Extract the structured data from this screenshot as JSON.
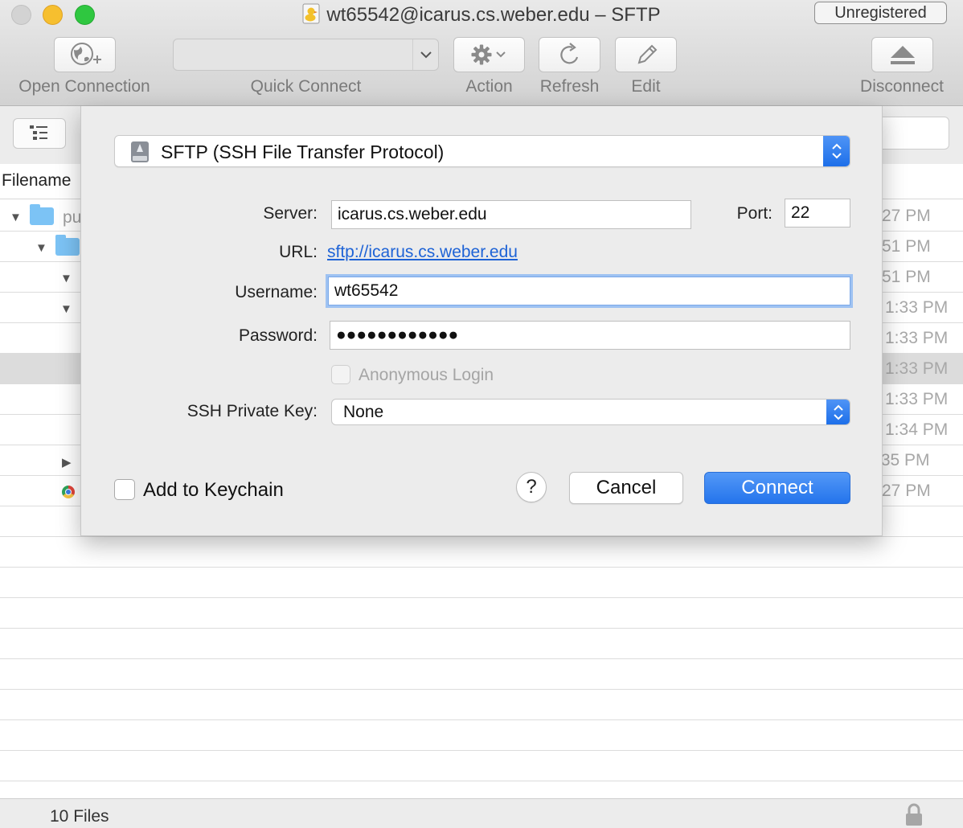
{
  "window": {
    "title": "wt65542@icarus.cs.weber.edu – SFTP",
    "badge": "Unregistered"
  },
  "toolbar": {
    "open_connection": "Open Connection",
    "quick_connect": "Quick Connect",
    "action": "Action",
    "refresh": "Refresh",
    "edit": "Edit",
    "disconnect": "Disconnect"
  },
  "browser": {
    "column_filename": "Filename",
    "rows": [
      {
        "name": "pu",
        "date": "27 PM"
      },
      {
        "name": "",
        "date": "51 PM"
      },
      {
        "name": "",
        "date": "51 PM"
      },
      {
        "name": "",
        "date": "1:33 PM"
      },
      {
        "name": "",
        "date": "1:33 PM"
      },
      {
        "name": "",
        "date": "1:33 PM"
      },
      {
        "name": "",
        "date": "1:33 PM"
      },
      {
        "name": "",
        "date": "1:34 PM"
      },
      {
        "name": "",
        "date": ":35 PM"
      },
      {
        "name": "",
        "date": "27 PM"
      }
    ],
    "status": "10 Files"
  },
  "sheet": {
    "protocol": "SFTP (SSH File Transfer Protocol)",
    "server_label": "Server:",
    "server_value": "icarus.cs.weber.edu",
    "port_label": "Port:",
    "port_value": "22",
    "url_label": "URL:",
    "url_value": "sftp://icarus.cs.weber.edu",
    "username_label": "Username:",
    "username_value": "wt65542",
    "password_label": "Password:",
    "password_value": "●●●●●●●●●●●●",
    "anonymous_label": "Anonymous Login",
    "key_label": "SSH Private Key:",
    "key_value": "None",
    "keychain_label": "Add to Keychain",
    "help_label": "?",
    "cancel_label": "Cancel",
    "connect_label": "Connect"
  },
  "colors": {
    "accent": "#2474ec",
    "link": "#1e63d6",
    "folder": "#7cc3f5"
  },
  "icons": [
    "globe-plus-icon",
    "chevron-down-icon",
    "gear-icon",
    "refresh-icon",
    "pencil-icon",
    "eject-icon",
    "outline-view-icon",
    "disk-icon",
    "up-down-stepper-icon",
    "lock-icon",
    "chrome-icon",
    "folder-icon"
  ]
}
